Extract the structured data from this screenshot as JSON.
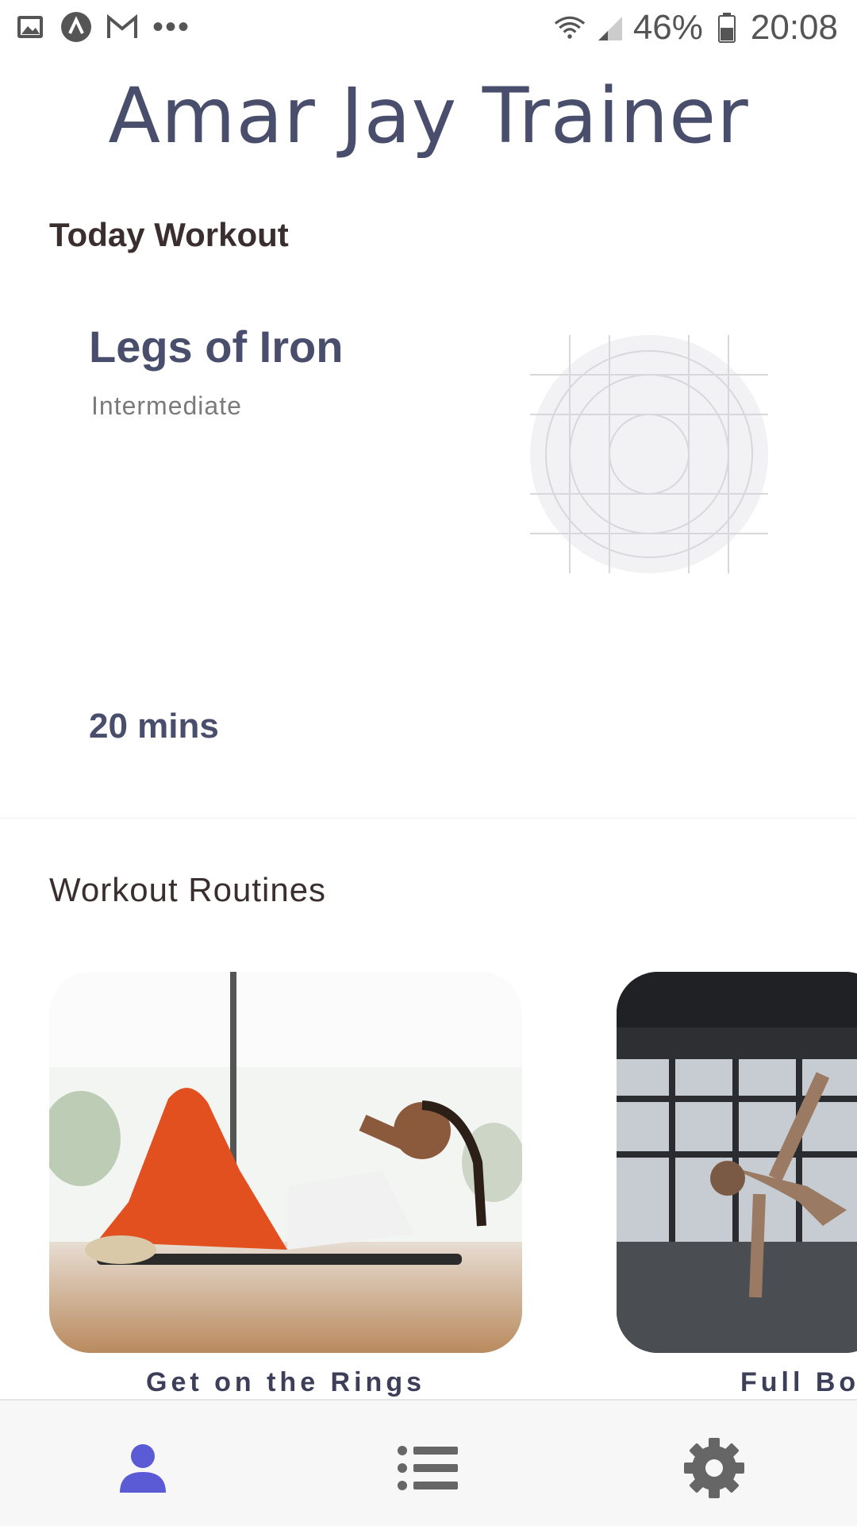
{
  "status_bar": {
    "battery": "46%",
    "time": "20:08",
    "dots": "•••",
    "icons": [
      "gallery-icon",
      "app-a-icon",
      "gmail-icon",
      "wifi-icon",
      "signal-icon",
      "battery-icon"
    ]
  },
  "app": {
    "title": "Amar Jay Trainer"
  },
  "today": {
    "section_title": "Today Workout",
    "workout": {
      "name": "Legs of Iron",
      "level": "Intermediate",
      "duration": "20 mins"
    }
  },
  "routines": {
    "section_title": "Workout Routines",
    "cards": [
      {
        "label": "Get on the Rings"
      },
      {
        "label": "Full Boc"
      }
    ]
  },
  "bottom_nav": {
    "active_color": "#5b5bd6",
    "inactive_color": "#666666",
    "items": [
      "profile-icon",
      "list-icon",
      "settings-icon"
    ]
  }
}
